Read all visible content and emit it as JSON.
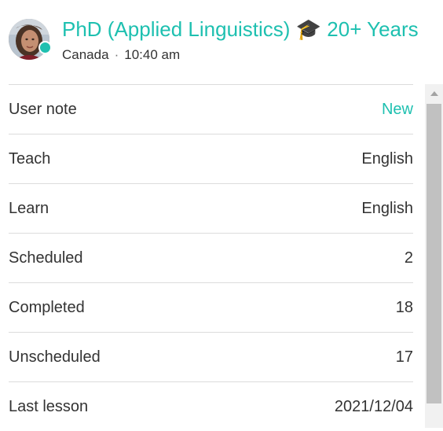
{
  "header": {
    "title": "PhD (Applied Linguistics) 🎓 20+ Years",
    "location": "Canada",
    "separator": "·",
    "local_time": "10:40 am",
    "status": "online"
  },
  "details": [
    {
      "label": "User note",
      "value": "New",
      "accent": true
    },
    {
      "label": "Teach",
      "value": "English"
    },
    {
      "label": "Learn",
      "value": "English"
    },
    {
      "label": "Scheduled",
      "value": "2"
    },
    {
      "label": "Completed",
      "value": "18"
    },
    {
      "label": "Unscheduled",
      "value": "17"
    },
    {
      "label": "Last lesson",
      "value": "2021/12/04"
    }
  ],
  "colors": {
    "accent": "#1ec0b0",
    "online": "#1fc0b0",
    "divider": "#dcdcdc",
    "text": "#333333"
  },
  "icons": {
    "avatar": "user-avatar-photo",
    "status": "online-status-dot",
    "scroll_up": "scroll-up-arrow-icon"
  }
}
